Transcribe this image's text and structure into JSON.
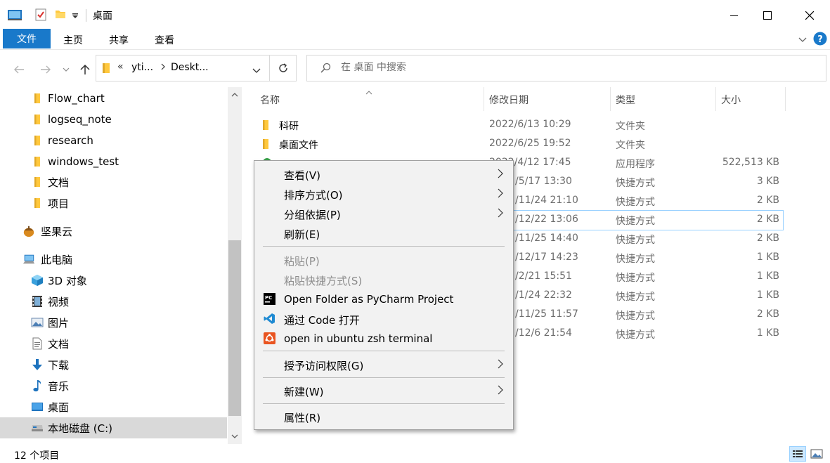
{
  "window": {
    "title": "桌面"
  },
  "ribbon": {
    "tabs": [
      "文件",
      "主页",
      "共享",
      "查看"
    ]
  },
  "address": {
    "prefix": "«",
    "segment1": "yti...",
    "segment2": "Deskt..."
  },
  "search": {
    "placeholder": "在 桌面 中搜索"
  },
  "nav": {
    "items": [
      {
        "label": "Flow_chart",
        "icon": "folder-icon"
      },
      {
        "label": "logseq_note",
        "icon": "folder-icon"
      },
      {
        "label": "research",
        "icon": "folder-icon"
      },
      {
        "label": "windows_test",
        "icon": "folder-icon"
      },
      {
        "label": "文档",
        "icon": "folder-icon"
      },
      {
        "label": "项目",
        "icon": "folder-icon"
      },
      {
        "label": "坚果云",
        "icon": "nut-icon"
      },
      {
        "label": "此电脑",
        "icon": "computer-icon"
      },
      {
        "label": "3D 对象",
        "icon": "cube-icon"
      },
      {
        "label": "视频",
        "icon": "video-icon"
      },
      {
        "label": "图片",
        "icon": "picture-icon"
      },
      {
        "label": "文档",
        "icon": "document-icon"
      },
      {
        "label": "下载",
        "icon": "download-icon"
      },
      {
        "label": "音乐",
        "icon": "music-icon"
      },
      {
        "label": "桌面",
        "icon": "desktop-icon"
      },
      {
        "label": "本地磁盘 (C:)",
        "icon": "drive-icon"
      }
    ]
  },
  "columns": {
    "name": "名称",
    "date": "修改日期",
    "type": "类型",
    "size": "大小"
  },
  "files": [
    {
      "name": "科研",
      "date": "2022/6/13 10:29",
      "type": "文件夹",
      "size": ""
    },
    {
      "name": "桌面文件",
      "date": "2022/6/25 19:52",
      "type": "文件夹",
      "size": ""
    },
    {
      "name": "",
      "date": "2022/4/12 17:45",
      "type": "应用程序",
      "size": "522,513 KB"
    },
    {
      "name": "",
      "date": "/5/17 13:30",
      "type": "快捷方式",
      "size": "3 KB"
    },
    {
      "name": "",
      "date": "/11/24 21:10",
      "type": "快捷方式",
      "size": "2 KB"
    },
    {
      "name": "",
      "date": "/12/22 13:06",
      "type": "快捷方式",
      "size": "2 KB"
    },
    {
      "name": "",
      "date": "/11/25 14:40",
      "type": "快捷方式",
      "size": "2 KB"
    },
    {
      "name": "",
      "date": "/12/17 14:23",
      "type": "快捷方式",
      "size": "1 KB"
    },
    {
      "name": "",
      "date": "/2/21 15:51",
      "type": "快捷方式",
      "size": "1 KB"
    },
    {
      "name": "",
      "date": "/1/24 22:32",
      "type": "快捷方式",
      "size": "1 KB"
    },
    {
      "name": "",
      "date": "/11/25 11:57",
      "type": "快捷方式",
      "size": "2 KB"
    },
    {
      "name": "",
      "date": "/12/6 21:54",
      "type": "快捷方式",
      "size": "1 KB"
    }
  ],
  "status": {
    "count": "12 个项目"
  },
  "context_menu": {
    "view": "查看(V)",
    "sort": "排序方式(O)",
    "group": "分组依据(P)",
    "refresh": "刷新(E)",
    "paste": "粘贴(P)",
    "paste_shortcut": "粘贴快捷方式(S)",
    "pycharm": "Open Folder as PyCharm Project",
    "vscode": "通过 Code 打开",
    "ubuntu": "open in ubuntu zsh terminal",
    "access": "授予访问权限(G)",
    "new": "新建(W)",
    "properties": "属性(R)"
  },
  "colors": {
    "accent": "#1979ca",
    "folder": "#ffc83d",
    "selection": "#cce8ff"
  }
}
